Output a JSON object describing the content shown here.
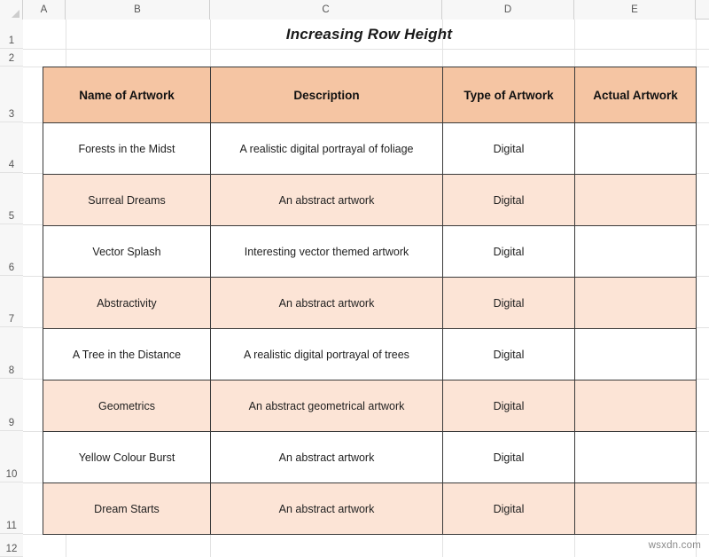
{
  "spreadsheet": {
    "column_headers": [
      "A",
      "B",
      "C",
      "D",
      "E"
    ],
    "row_headers": [
      "1",
      "2",
      "3",
      "4",
      "5",
      "6",
      "7",
      "8",
      "9",
      "10",
      "11",
      "12"
    ],
    "colors": {
      "header_fill": "#F5C5A3",
      "alt_row_fill": "#FCE4D6",
      "plain_row_fill": "#FFFFFF",
      "border": "#3A3A3A",
      "gridline": "#E2E2E2",
      "header_strip": "#F7F7F7"
    }
  },
  "title": "Increasing Row Height",
  "table": {
    "headers": [
      "Name of Artwork",
      "Description",
      "Type of Artwork",
      "Actual Artwork"
    ],
    "rows": [
      {
        "name": "Forests in the Midst",
        "description": "A realistic digital portrayal of  foliage",
        "type": "Digital",
        "artwork": "",
        "shaded": false
      },
      {
        "name": "Surreal Dreams",
        "description": "An abstract artwork",
        "type": "Digital",
        "artwork": "",
        "shaded": true
      },
      {
        "name": "Vector Splash",
        "description": "Interesting vector themed artwork",
        "type": "Digital",
        "artwork": "",
        "shaded": false
      },
      {
        "name": "Abstractivity",
        "description": "An abstract artwork",
        "type": "Digital",
        "artwork": "",
        "shaded": true
      },
      {
        "name": "A Tree in the Distance",
        "description": "A realistic digital portrayal of trees",
        "type": "Digital",
        "artwork": "",
        "shaded": false
      },
      {
        "name": "Geometrics",
        "description": "An abstract geometrical artwork",
        "type": "Digital",
        "artwork": "",
        "shaded": true
      },
      {
        "name": "Yellow Colour Burst",
        "description": "An abstract artwork",
        "type": "Digital",
        "artwork": "",
        "shaded": false
      },
      {
        "name": "Dream Starts",
        "description": "An abstract artwork",
        "type": "Digital",
        "artwork": "",
        "shaded": true
      }
    ]
  },
  "watermark": "wsxdn.com"
}
